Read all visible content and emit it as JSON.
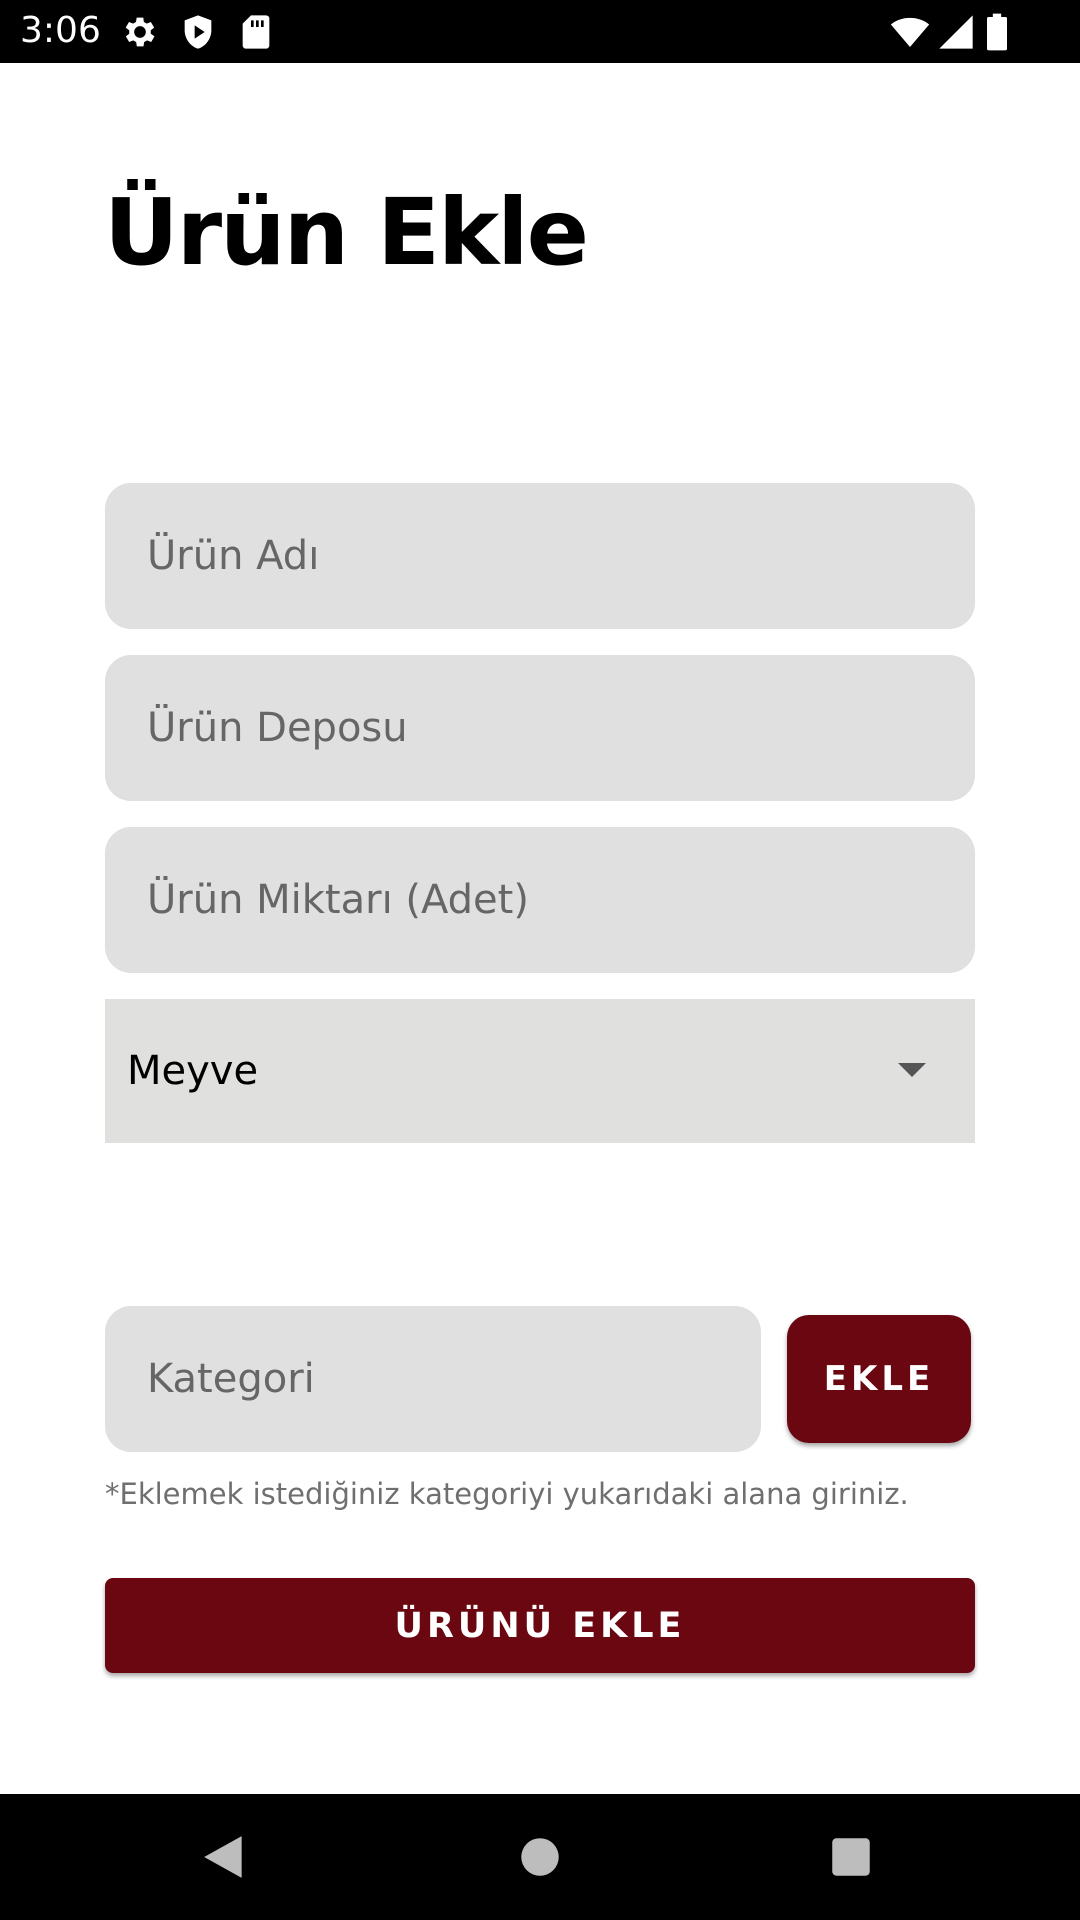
{
  "status_bar": {
    "time": "3:06",
    "icons": [
      "gear-icon",
      "play-protect-icon",
      "sd-card-icon",
      "wifi-icon",
      "signal-icon",
      "battery-icon"
    ]
  },
  "page": {
    "title": "Ürün Ekle"
  },
  "form": {
    "product_name_placeholder": "Ürün Adı",
    "product_depot_placeholder": "Ürün Deposu",
    "product_quantity_placeholder": "Ürün Miktarı (Adet)",
    "category_select_value": "Meyve",
    "category_input_placeholder": "Kategori",
    "add_category_label": "EKLE",
    "hint": "*Eklemek istediğiniz kategoriyi yukarıdaki alana giriniz.",
    "submit_label": "ÜRÜNÜ EKLE"
  },
  "colors": {
    "accent": "#6a0711",
    "field_bg": "#e0e0e0",
    "placeholder": "#666666"
  },
  "nav_bar": {
    "icons": [
      "back-icon",
      "home-icon",
      "recents-icon"
    ]
  }
}
